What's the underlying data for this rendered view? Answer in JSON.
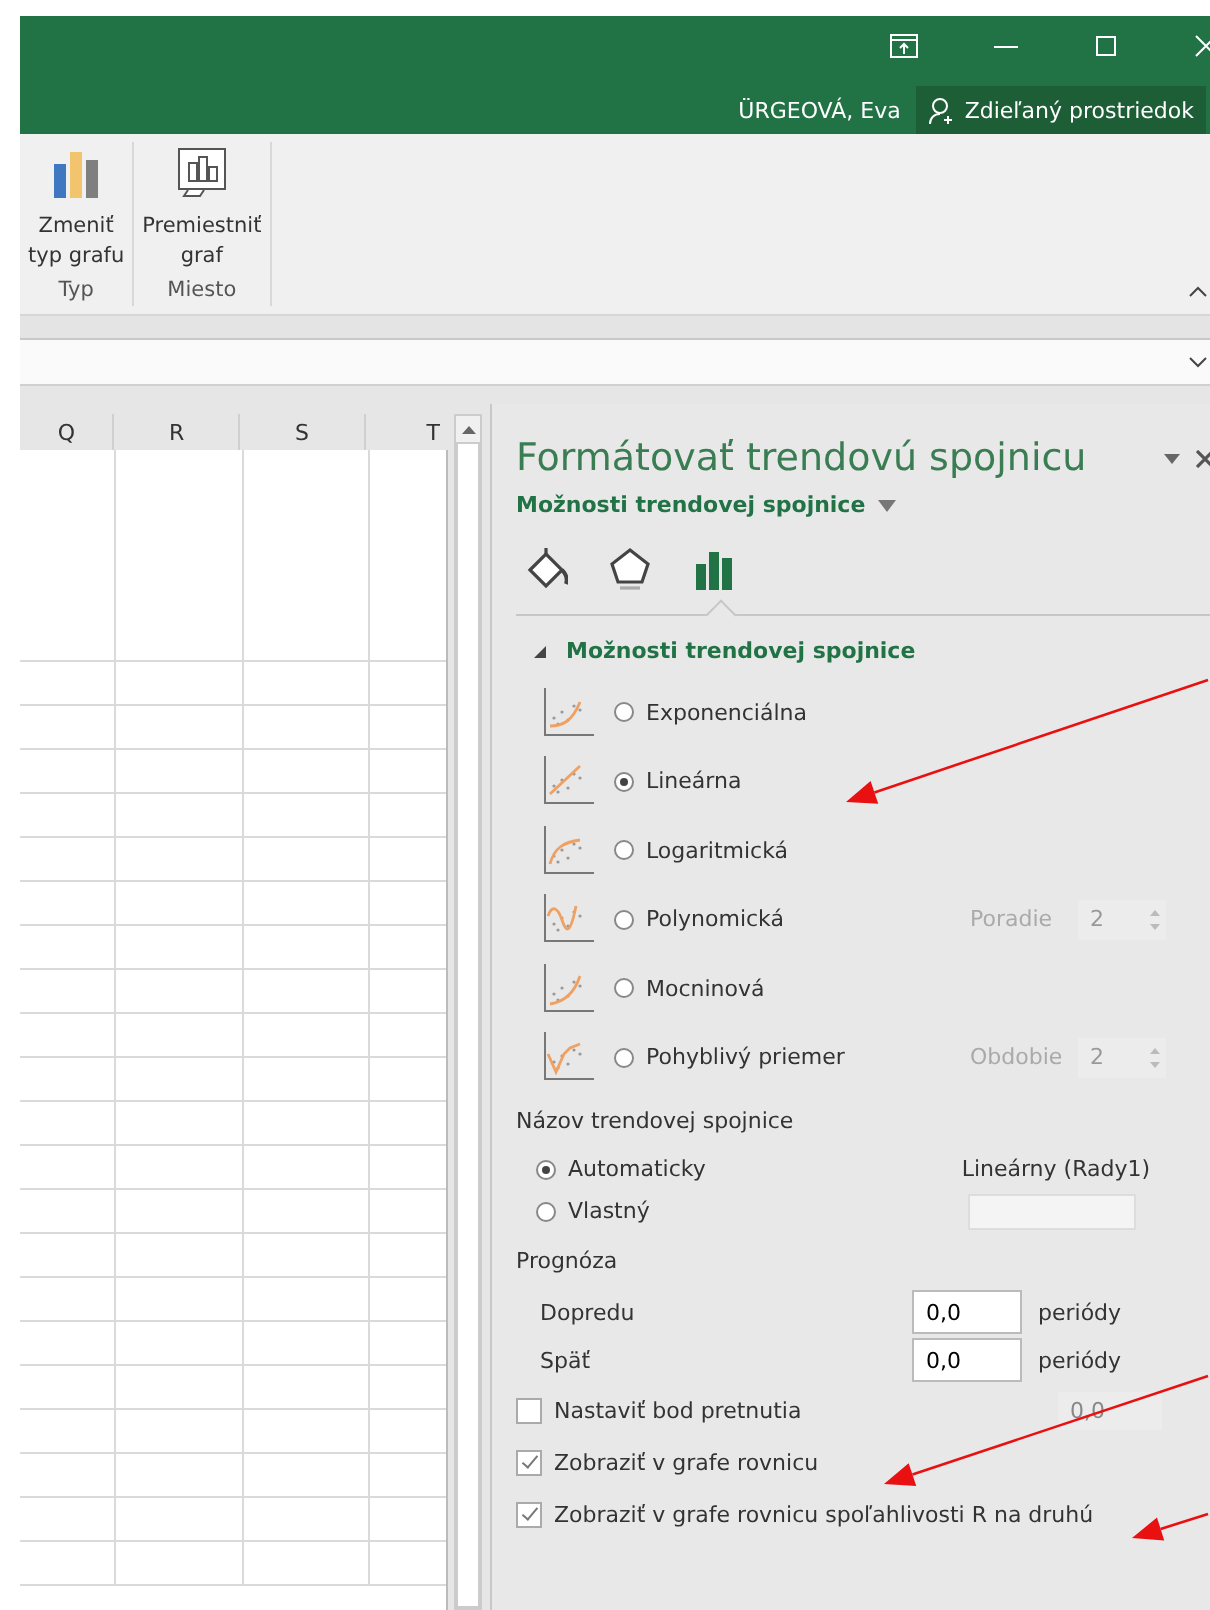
{
  "title_bar": {
    "user": "ÜRGEOVÁ, Eva",
    "share_button": "Zdieľaný prostriedok"
  },
  "ribbon": {
    "groups": [
      {
        "label": "Typ",
        "buttons": [
          {
            "label": "Zmeniť\ntyp grafu",
            "kind": "chart-type"
          }
        ]
      },
      {
        "label": "Miesto",
        "buttons": [
          {
            "label": "Premiestniť\ngraf",
            "kind": "move"
          }
        ]
      }
    ]
  },
  "sheet": {
    "columns": [
      "Q",
      "R",
      "S",
      "T"
    ]
  },
  "panel": {
    "title": "Formátovať trendovú spojnicu",
    "subtitle": "Možnosti trendovej spojnice",
    "tabs": [
      {
        "kind": "fill",
        "selected": false
      },
      {
        "kind": "effects",
        "selected": false
      },
      {
        "kind": "options",
        "selected": true
      }
    ],
    "section": {
      "label": "Možnosti trendovej spojnice",
      "expanded": true
    },
    "trend_types": [
      {
        "kind": "exponential",
        "label": "Exponenciálna",
        "selected": false
      },
      {
        "kind": "linear",
        "label": "Lineárna",
        "selected": true
      },
      {
        "kind": "logarithmic",
        "label": "Logaritmická",
        "selected": false
      },
      {
        "kind": "polynomial",
        "label": "Polynomická",
        "selected": false,
        "param": {
          "label": "Poradie",
          "value": "2",
          "disabled": true
        }
      },
      {
        "kind": "power",
        "label": "Mocninová",
        "selected": false
      },
      {
        "kind": "moving",
        "label": "Pohyblivý priemer",
        "selected": false,
        "param": {
          "label": "Obdobie",
          "value": "2",
          "disabled": true
        }
      }
    ],
    "name": {
      "heading": "Názov trendovej spojnice",
      "options": [
        {
          "label": "Automaticky",
          "selected": true,
          "value": "Lineárny (Rady1)"
        },
        {
          "label": "Vlastný",
          "selected": false,
          "field_disabled": true
        }
      ]
    },
    "forecast": {
      "heading": "Prognóza",
      "rows": [
        {
          "label": "Dopredu",
          "value": "0,0",
          "unit": "periódy"
        },
        {
          "label": "Späť",
          "value": "0,0",
          "unit": "periódy"
        }
      ]
    },
    "checks": [
      {
        "label": "Nastaviť bod pretnutia",
        "checked": false,
        "value": "0,0"
      },
      {
        "label": "Zobraziť v grafe rovnicu",
        "checked": true
      },
      {
        "label": "Zobraziť v grafe rovnicu spoľahlivosti R na druhú",
        "checked": true
      }
    ]
  }
}
